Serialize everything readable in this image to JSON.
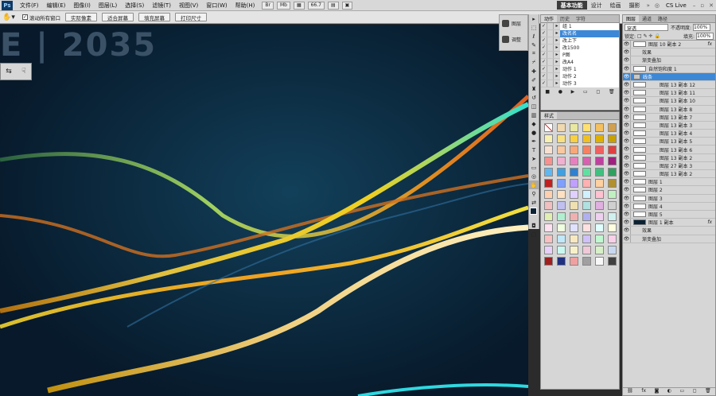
{
  "menubar": {
    "logo": "Ps",
    "items": [
      "文件(F)",
      "编辑(E)",
      "图像(I)",
      "图层(L)",
      "选择(S)",
      "滤镜(T)",
      "视图(V)",
      "窗口(W)",
      "帮助(H)"
    ],
    "zoom": "66.7",
    "workspaces": [
      "基本功能",
      "设计",
      "绘画",
      "摄影"
    ],
    "cslive": "CS Live"
  },
  "options": {
    "scroll_all": "滚动所有窗口",
    "buttons": [
      "实际像素",
      "适合屏幕",
      "填充屏幕",
      "打印尺寸"
    ]
  },
  "canvas": {
    "title": "E | 2035"
  },
  "dock": {
    "items": [
      "图层",
      "调整"
    ]
  },
  "actions_panel": {
    "tabs": [
      "动作",
      "历史",
      "字符"
    ],
    "rows": [
      {
        "label": "组 1",
        "selected": false
      },
      {
        "label": "改名名",
        "selected": true
      },
      {
        "label": "改上下",
        "selected": false
      },
      {
        "label": "改1500",
        "selected": false
      },
      {
        "label": "P图",
        "selected": false
      },
      {
        "label": "改A4",
        "selected": false
      },
      {
        "label": "动作 1",
        "selected": false
      },
      {
        "label": "动作 2",
        "selected": false
      },
      {
        "label": "动作 3",
        "selected": false
      }
    ]
  },
  "styles_panel": {
    "tabs": [
      "样式"
    ],
    "swatches": [
      "#ffffff",
      "#f0d8b0",
      "#e8e8a0",
      "#ffe070",
      "#f4c060",
      "#d0a050",
      "#f8f0b0",
      "#f8e080",
      "#f8d040",
      "#f0c020",
      "#e0b000",
      "#c8a000",
      "#f8e0d0",
      "#f8c8a0",
      "#f8a878",
      "#f88060",
      "#f06060",
      "#e04040",
      "#f89090",
      "#f0b0d0",
      "#e880c0",
      "#d860b0",
      "#c040a0",
      "#a02080",
      "#60b8f0",
      "#40a0e0",
      "#3080d0",
      "#60e0a0",
      "#40c080",
      "#30a060",
      "#c02020",
      "#80a0ff",
      "#c0a0ff",
      "#ffb0b0",
      "#ffd0a0",
      "#b09030",
      "#ffd0b0",
      "#ffe0c0",
      "#e0d0ff",
      "#d0f0ff",
      "#ffc0d0",
      "#c0f0c0",
      "#f0c0c0",
      "#c0c0f0",
      "#f0e0b0",
      "#b0e0e0",
      "#e0b0e0",
      "#d0d0d0",
      "#e0f0b0",
      "#b0f0d0",
      "#f0b0b0",
      "#b0b0f0",
      "#f0d0f0",
      "#d0f0f0",
      "#ffe0f0",
      "#f0ffe0",
      "#e0e0ff",
      "#ffe0e0",
      "#e0ffff",
      "#ffffe0",
      "#f8c0c0",
      "#c0e8f8",
      "#f8e8c0",
      "#d0c0f8",
      "#c0f8d0",
      "#f8d0e8",
      "#e8d0f8",
      "#c8f8f0",
      "#f8f0c8",
      "#f0c8d8",
      "#d8f0c8",
      "#c8d8f0",
      "#a02020",
      "#203080",
      "#f0a0a0",
      "#a0a0a0",
      "#f8f8f8",
      "#404040"
    ]
  },
  "layers_panel": {
    "tabs": [
      "图层",
      "通道",
      "路径"
    ],
    "blend_mode": "穿透",
    "opacity_label": "不透明度:",
    "opacity": "100%",
    "lock_label": "锁定:",
    "fill_label": "填充:",
    "fill": "100%",
    "rows": [
      {
        "name": "图层 10 副本 2",
        "fx": "fx",
        "sub": false,
        "sel": false,
        "dark": false
      },
      {
        "name": "效果",
        "fx": "",
        "sub": true,
        "sel": false,
        "dark": false
      },
      {
        "name": "渐变叠加",
        "fx": "",
        "sub": true,
        "sel": false,
        "dark": false
      },
      {
        "name": "自然饱和度 1",
        "fx": "",
        "sub": false,
        "sel": false,
        "dark": false
      },
      {
        "name": "线条",
        "fx": "",
        "sub": false,
        "sel": true,
        "dark": false
      },
      {
        "name": "图层 13 副本 12",
        "fx": "",
        "sub": true,
        "sel": false,
        "dark": false
      },
      {
        "name": "图层 13 副本 11",
        "fx": "",
        "sub": true,
        "sel": false,
        "dark": false
      },
      {
        "name": "图层 13 副本 10",
        "fx": "",
        "sub": true,
        "sel": false,
        "dark": false
      },
      {
        "name": "图层 13 副本 8",
        "fx": "",
        "sub": true,
        "sel": false,
        "dark": false
      },
      {
        "name": "图层 13 副本 7",
        "fx": "",
        "sub": true,
        "sel": false,
        "dark": false
      },
      {
        "name": "图层 13 副本 3",
        "fx": "",
        "sub": true,
        "sel": false,
        "dark": false
      },
      {
        "name": "图层 13 副本 4",
        "fx": "",
        "sub": true,
        "sel": false,
        "dark": false
      },
      {
        "name": "图层 13 副本 5",
        "fx": "",
        "sub": true,
        "sel": false,
        "dark": false
      },
      {
        "name": "图层 13 副本 6",
        "fx": "",
        "sub": true,
        "sel": false,
        "dark": false
      },
      {
        "name": "图层 13 副本 2",
        "fx": "",
        "sub": true,
        "sel": false,
        "dark": false
      },
      {
        "name": "图层 27 副本 3",
        "fx": "",
        "sub": true,
        "sel": false,
        "dark": false
      },
      {
        "name": "图层 13 副本 2",
        "fx": "",
        "sub": true,
        "sel": false,
        "dark": false
      },
      {
        "name": "图层 1",
        "fx": "",
        "sub": false,
        "sel": false,
        "dark": false
      },
      {
        "name": "图层 2",
        "fx": "",
        "sub": false,
        "sel": false,
        "dark": false
      },
      {
        "name": "图层 3",
        "fx": "",
        "sub": false,
        "sel": false,
        "dark": false
      },
      {
        "name": "图层 4",
        "fx": "",
        "sub": false,
        "sel": false,
        "dark": false
      },
      {
        "name": "图层 5",
        "fx": "",
        "sub": false,
        "sel": false,
        "dark": false
      },
      {
        "name": "图层 1 副本",
        "fx": "fx",
        "sub": false,
        "sel": false,
        "dark": true
      },
      {
        "name": "效果",
        "fx": "",
        "sub": true,
        "sel": false,
        "dark": false
      },
      {
        "name": "渐变叠加",
        "fx": "",
        "sub": true,
        "sel": false,
        "dark": false
      }
    ]
  }
}
